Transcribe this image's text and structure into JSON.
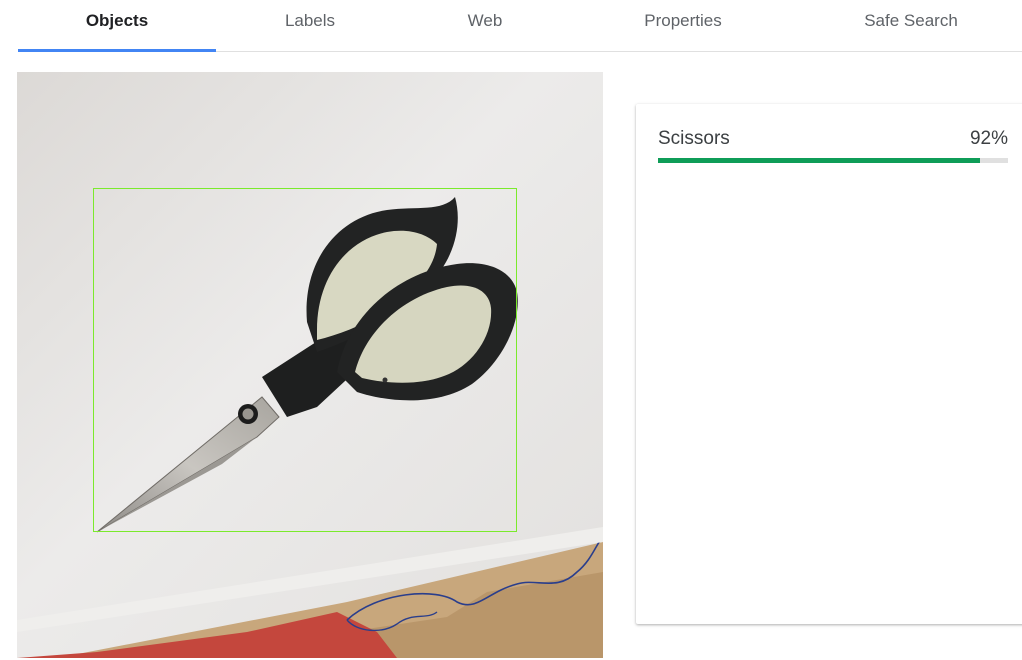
{
  "tabs": [
    {
      "label": "Objects",
      "active": true
    },
    {
      "label": "Labels",
      "active": false
    },
    {
      "label": "Web",
      "active": false
    },
    {
      "label": "Properties",
      "active": false
    },
    {
      "label": "Safe Search",
      "active": false
    }
  ],
  "colors": {
    "active_tab_underline": "#4285f4",
    "bounding_box": "#7bea2c",
    "confidence_bar": "#0f9d58",
    "bar_track": "#e0e0e0"
  },
  "objects": [
    {
      "name": "Scissors",
      "confidence_text": "92%",
      "confidence": 0.92
    }
  ]
}
